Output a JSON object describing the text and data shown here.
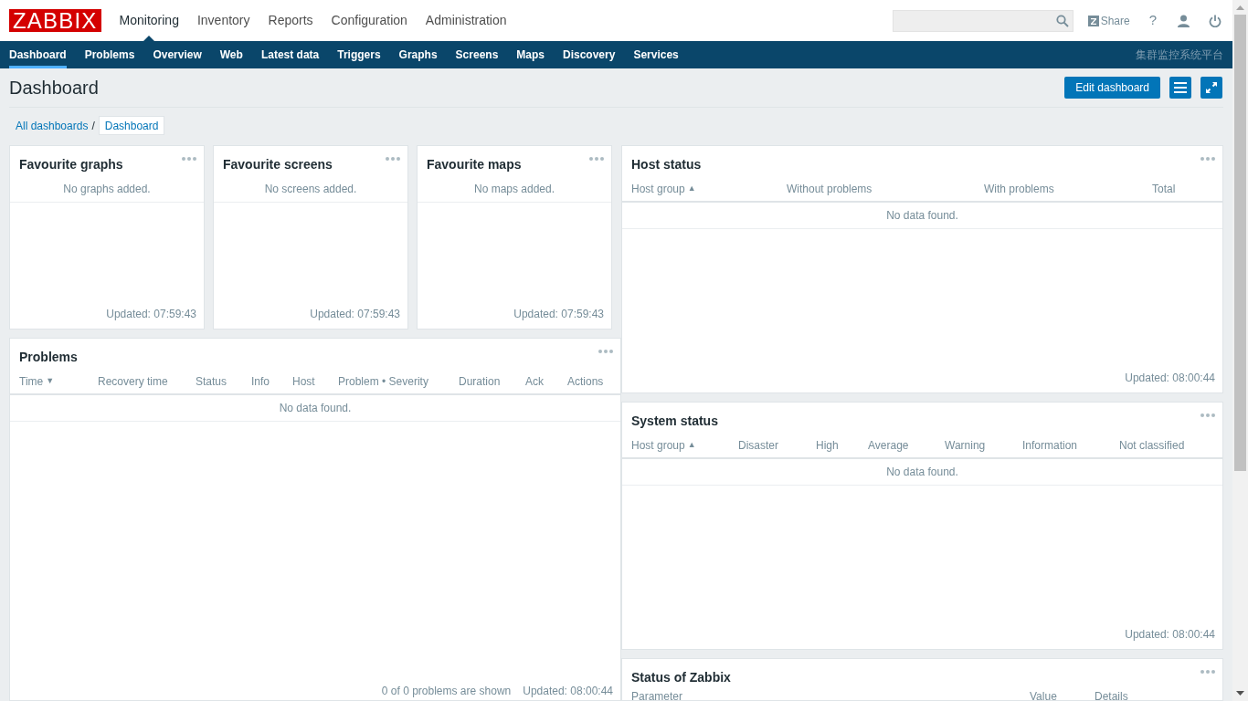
{
  "header": {
    "logo": "ZABBIX",
    "menu": [
      {
        "label": "Monitoring",
        "selected": true
      },
      {
        "label": "Inventory",
        "selected": false
      },
      {
        "label": "Reports",
        "selected": false
      },
      {
        "label": "Configuration",
        "selected": false
      },
      {
        "label": "Administration",
        "selected": false
      }
    ],
    "share": "Share",
    "help": "?"
  },
  "subnav": {
    "items": [
      {
        "label": "Dashboard",
        "selected": true
      },
      {
        "label": "Problems",
        "selected": false
      },
      {
        "label": "Overview",
        "selected": false
      },
      {
        "label": "Web",
        "selected": false
      },
      {
        "label": "Latest data",
        "selected": false
      },
      {
        "label": "Triggers",
        "selected": false
      },
      {
        "label": "Graphs",
        "selected": false
      },
      {
        "label": "Screens",
        "selected": false
      },
      {
        "label": "Maps",
        "selected": false
      },
      {
        "label": "Discovery",
        "selected": false
      },
      {
        "label": "Services",
        "selected": false
      }
    ],
    "brand": "集群监控系统平台"
  },
  "page": {
    "title": "Dashboard",
    "edit_button": "Edit dashboard"
  },
  "breadcrumbs": {
    "separator": "/",
    "items": [
      {
        "label": "All dashboards",
        "selected": false
      },
      {
        "label": "Dashboard",
        "selected": true
      }
    ]
  },
  "favourites": [
    {
      "title": "Favourite graphs",
      "message": "No graphs added.",
      "updated": "Updated: 07:59:43"
    },
    {
      "title": "Favourite screens",
      "message": "No screens added.",
      "updated": "Updated: 07:59:43"
    },
    {
      "title": "Favourite maps",
      "message": "No maps added.",
      "updated": "Updated: 07:59:43"
    }
  ],
  "problems": {
    "title": "Problems",
    "columns": [
      {
        "label": "Time",
        "sort_mark": "▼"
      },
      {
        "label": "Recovery time"
      },
      {
        "label": "Status"
      },
      {
        "label": "Info"
      },
      {
        "label": "Host"
      },
      {
        "label": "Problem • Severity"
      },
      {
        "label": "Duration"
      },
      {
        "label": "Ack"
      },
      {
        "label": "Actions"
      }
    ],
    "message": "No data found.",
    "shown": "0 of 0 problems are shown",
    "updated": "Updated: 08:00:44"
  },
  "host_status": {
    "title": "Host status",
    "columns": [
      {
        "label": "Host group",
        "sort_mark": "▲"
      },
      {
        "label": "Without problems"
      },
      {
        "label": "With problems"
      },
      {
        "label": "Total"
      }
    ],
    "message": "No data found.",
    "updated": "Updated: 08:00:44"
  },
  "system_status": {
    "title": "System status",
    "columns": [
      {
        "label": "Host group",
        "sort_mark": "▲"
      },
      {
        "label": "Disaster"
      },
      {
        "label": "High"
      },
      {
        "label": "Average"
      },
      {
        "label": "Warning"
      },
      {
        "label": "Information"
      },
      {
        "label": "Not classified"
      }
    ],
    "message": "No data found.",
    "updated": "Updated: 08:00:44"
  },
  "zabbix_status": {
    "title": "Status of Zabbix",
    "columns": [
      {
        "label": "Parameter"
      },
      {
        "label": "Value"
      },
      {
        "label": "Details"
      }
    ]
  }
}
